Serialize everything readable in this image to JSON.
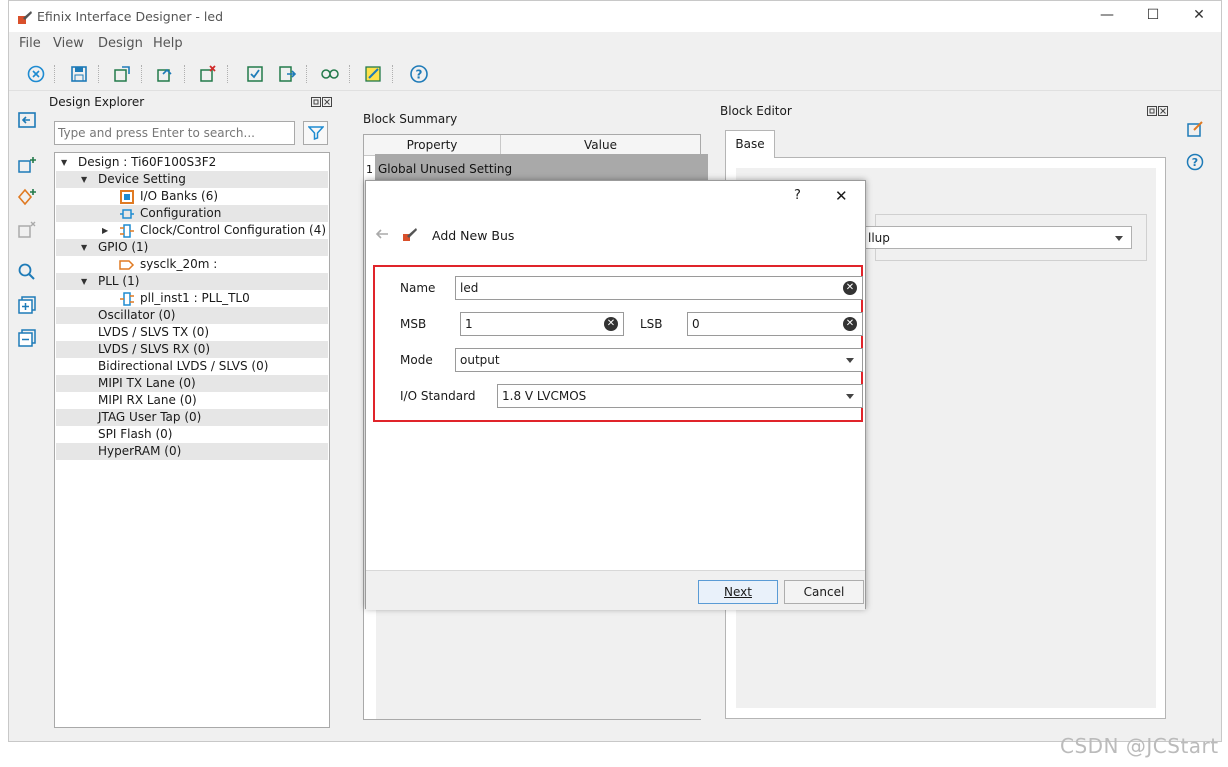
{
  "window": {
    "title": "Efinix Interface Designer - led"
  },
  "menu": [
    {
      "label": "File"
    },
    {
      "label": "View"
    },
    {
      "label": "Design"
    },
    {
      "label": "Help"
    }
  ],
  "explorer": {
    "title": "Design Explorer",
    "search_placeholder": "Type and press Enter to search...",
    "tree": [
      {
        "label": "Design : Ti60F100S3F2",
        "icon": "expanded-arrow-icon"
      },
      {
        "label": "Device Setting",
        "icon": "expanded-arrow-icon"
      },
      {
        "label": "I/O Banks (6)",
        "icon": "io-banks-icon"
      },
      {
        "label": "Configuration",
        "icon": "configuration-icon"
      },
      {
        "label": "Clock/Control Configuration (4)",
        "icon": "clock-control-icon"
      },
      {
        "label": "GPIO (1)",
        "icon": "expanded-arrow-icon"
      },
      {
        "label": "sysclk_20m :",
        "icon": "gpio-input-icon"
      },
      {
        "label": "PLL (1)",
        "icon": "expanded-arrow-icon"
      },
      {
        "label": "pll_inst1 : PLL_TL0",
        "icon": "pll-icon"
      },
      {
        "label": "Oscillator (0)"
      },
      {
        "label": "LVDS / SLVS TX (0)"
      },
      {
        "label": "LVDS / SLVS RX (0)"
      },
      {
        "label": "Bidirectional LVDS / SLVS (0)"
      },
      {
        "label": "MIPI TX Lane (0)"
      },
      {
        "label": "MIPI RX Lane (0)"
      },
      {
        "label": "JTAG User Tap (0)"
      },
      {
        "label": "SPI Flash (0)"
      },
      {
        "label": "HyperRAM (0)"
      }
    ]
  },
  "summary": {
    "title": "Block Summary",
    "columns": [
      "Property",
      "Value"
    ],
    "row_index": "1",
    "row_property": "Global Unused Setting"
  },
  "editor": {
    "title": "Block Editor",
    "tab": "Base",
    "combo_value": "llup"
  },
  "dialog": {
    "help": "?",
    "close": "✕",
    "heading": "Add New Bus",
    "name_label": "Name",
    "name_value": "led",
    "msb_label": "MSB",
    "msb_value": "1",
    "lsb_label": "LSB",
    "lsb_value": "0",
    "mode_label": "Mode",
    "mode_value": "output",
    "io_label": "I/O Standard",
    "io_value": "1.8 V LVCMOS",
    "next": "Next",
    "cancel": "Cancel"
  },
  "watermark": "CSDN @JCStart"
}
